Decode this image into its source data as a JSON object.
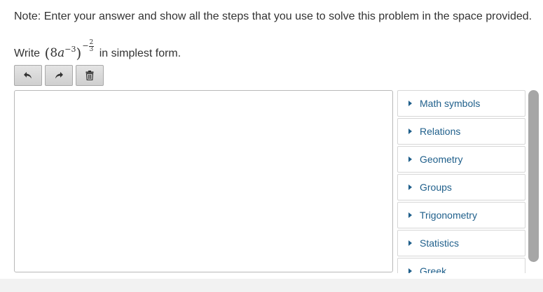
{
  "note": "Note: Enter your answer and show all the steps that you use to solve this problem in the space provided.",
  "question": {
    "prefix": "Write",
    "expression": {
      "open_paren": "(",
      "coefficient": "8",
      "variable": "a",
      "inner_exponent": "−3",
      "close_paren": ")",
      "outer_sign": "−",
      "outer_numerator": "2",
      "outer_denominator": "3"
    },
    "suffix": "in simplest form."
  },
  "toolbar": {
    "undo_icon": "undo-icon",
    "redo_icon": "redo-icon",
    "delete_icon": "trash-icon"
  },
  "palette": {
    "items": [
      {
        "label": "Math symbols"
      },
      {
        "label": "Relations"
      },
      {
        "label": "Geometry"
      },
      {
        "label": "Groups"
      },
      {
        "label": "Trigonometry"
      },
      {
        "label": "Statistics"
      },
      {
        "label": "Greek"
      }
    ]
  },
  "colors": {
    "link": "#1f5f8b",
    "text": "#333333",
    "button_bg": "#d8d8d8",
    "scrollbar": "#a6a6a6"
  }
}
